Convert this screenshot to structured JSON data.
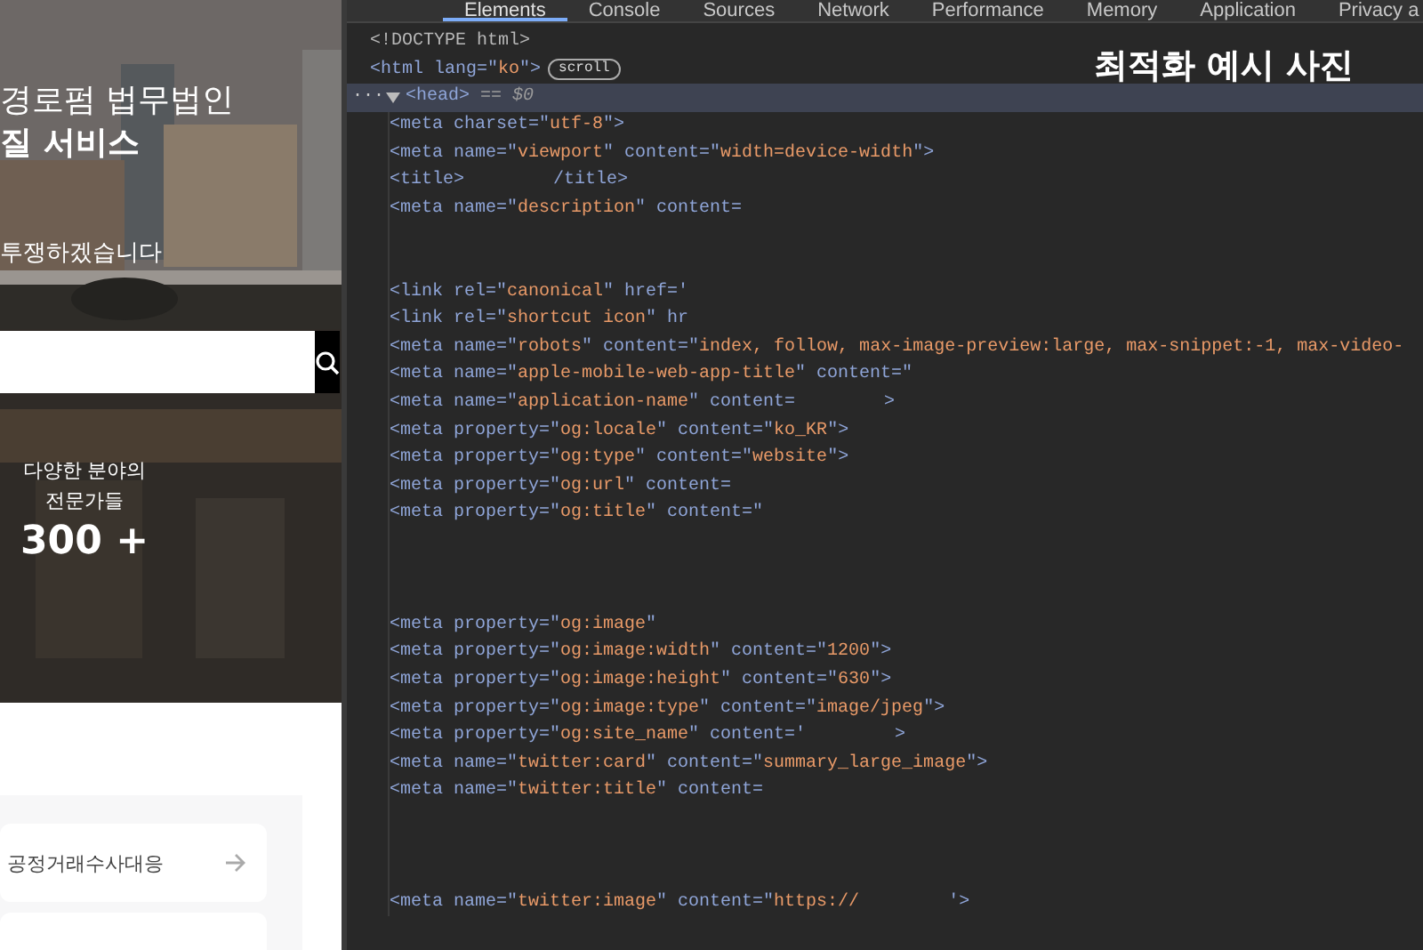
{
  "website": {
    "headline": "경로펌 법무법인",
    "subheadline": "질 서비스",
    "tagline": "투쟁하겠습니다",
    "stat": {
      "label": "다양한 분야의 전문가들",
      "value": "300 +"
    },
    "practice_areas": [
      {
        "label": "공정거래수사대응"
      }
    ]
  },
  "devtools": {
    "tabs": [
      {
        "label": "Elements",
        "selected": true
      },
      {
        "label": "Console",
        "selected": false
      },
      {
        "label": "Sources",
        "selected": false
      },
      {
        "label": "Network",
        "selected": false
      },
      {
        "label": "Performance",
        "selected": false
      },
      {
        "label": "Memory",
        "selected": false
      },
      {
        "label": "Application",
        "selected": false
      },
      {
        "label": "Privacy a",
        "selected": false
      }
    ],
    "caption": "최적화 예시 사진",
    "dom": [
      {
        "kind": "line",
        "selected": false,
        "tokens": [
          {
            "kind": "plain",
            "text": "<!DOCTYPE html>"
          }
        ]
      },
      {
        "kind": "line",
        "selected": false,
        "badge": "scroll",
        "tokens": [
          {
            "kind": "markup",
            "text": "<html lang=\""
          },
          {
            "kind": "value",
            "text": "ko"
          },
          {
            "kind": "markup",
            "text": "\">"
          }
        ],
        "children": [
          {
            "kind": "line",
            "selected": true,
            "expanded": true,
            "marker": "···",
            "note": "== $0",
            "tokens": [
              {
                "kind": "markup",
                "text": "<head>"
              }
            ],
            "children": [
              {
                "kind": "line",
                "selected": false,
                "tokens": [
                  {
                    "kind": "markup",
                    "text": "<meta charset=\""
                  },
                  {
                    "kind": "value",
                    "text": "utf-8"
                  },
                  {
                    "kind": "markup",
                    "text": "\">"
                  }
                ]
              },
              {
                "kind": "line",
                "selected": false,
                "tokens": [
                  {
                    "kind": "markup",
                    "text": "<meta name=\""
                  },
                  {
                    "kind": "value",
                    "text": "viewport"
                  },
                  {
                    "kind": "markup",
                    "text": "\" content=\""
                  },
                  {
                    "kind": "value",
                    "text": "width=device-width"
                  },
                  {
                    "kind": "markup",
                    "text": "\">"
                  }
                ]
              },
              {
                "kind": "line",
                "selected": false,
                "tokens": [
                  {
                    "kind": "markup",
                    "text": "<title>"
                  },
                  {
                    "kind": "gap"
                  },
                  {
                    "kind": "markup",
                    "text": "/title>"
                  }
                ]
              },
              {
                "kind": "line",
                "selected": false,
                "tokens": [
                  {
                    "kind": "markup",
                    "text": "<meta name=\""
                  },
                  {
                    "kind": "value",
                    "text": "description"
                  },
                  {
                    "kind": "markup",
                    "text": "\" content="
                  }
                ]
              },
              {
                "kind": "redacted",
                "selected": false
              },
              {
                "kind": "redacted",
                "selected": false
              },
              {
                "kind": "line",
                "selected": false,
                "tokens": [
                  {
                    "kind": "markup",
                    "text": "<link rel=\""
                  },
                  {
                    "kind": "value",
                    "text": "canonical"
                  },
                  {
                    "kind": "markup",
                    "text": "\" href='"
                  }
                ]
              },
              {
                "kind": "line",
                "selected": false,
                "tokens": [
                  {
                    "kind": "markup",
                    "text": "<link rel=\""
                  },
                  {
                    "kind": "value",
                    "text": "shortcut icon"
                  },
                  {
                    "kind": "markup",
                    "text": "\" hr"
                  }
                ]
              },
              {
                "kind": "line",
                "selected": false,
                "tokens": [
                  {
                    "kind": "markup",
                    "text": "<meta name=\""
                  },
                  {
                    "kind": "value",
                    "text": "robots"
                  },
                  {
                    "kind": "markup",
                    "text": "\" content=\""
                  },
                  {
                    "kind": "value",
                    "text": "index, follow, max-image-preview:large, max-snippet:-1, max-video-"
                  }
                ]
              },
              {
                "kind": "line",
                "selected": false,
                "tokens": [
                  {
                    "kind": "markup",
                    "text": "<meta name=\""
                  },
                  {
                    "kind": "value",
                    "text": "apple-mobile-web-app-title"
                  },
                  {
                    "kind": "markup",
                    "text": "\" content=\""
                  }
                ]
              },
              {
                "kind": "line",
                "selected": false,
                "tokens": [
                  {
                    "kind": "markup",
                    "text": "<meta name=\""
                  },
                  {
                    "kind": "value",
                    "text": "application-name"
                  },
                  {
                    "kind": "markup",
                    "text": "\" content="
                  },
                  {
                    "kind": "gap"
                  },
                  {
                    "kind": "markup",
                    "text": ">"
                  }
                ]
              },
              {
                "kind": "line",
                "selected": false,
                "tokens": [
                  {
                    "kind": "markup",
                    "text": "<meta property=\""
                  },
                  {
                    "kind": "value",
                    "text": "og:locale"
                  },
                  {
                    "kind": "markup",
                    "text": "\" content=\""
                  },
                  {
                    "kind": "value",
                    "text": "ko_KR"
                  },
                  {
                    "kind": "markup",
                    "text": "\">"
                  }
                ]
              },
              {
                "kind": "line",
                "selected": false,
                "tokens": [
                  {
                    "kind": "markup",
                    "text": "<meta property=\""
                  },
                  {
                    "kind": "value",
                    "text": "og:type"
                  },
                  {
                    "kind": "markup",
                    "text": "\" content=\""
                  },
                  {
                    "kind": "value",
                    "text": "website"
                  },
                  {
                    "kind": "markup",
                    "text": "\">"
                  }
                ]
              },
              {
                "kind": "line",
                "selected": false,
                "tokens": [
                  {
                    "kind": "markup",
                    "text": "<meta property=\""
                  },
                  {
                    "kind": "value",
                    "text": "og:url"
                  },
                  {
                    "kind": "markup",
                    "text": "\" content="
                  }
                ]
              },
              {
                "kind": "line",
                "selected": false,
                "tokens": [
                  {
                    "kind": "markup",
                    "text": "<meta property=\""
                  },
                  {
                    "kind": "value",
                    "text": "og:title"
                  },
                  {
                    "kind": "markup",
                    "text": "\" content=\""
                  }
                ]
              },
              {
                "kind": "redacted",
                "selected": false
              },
              {
                "kind": "redacted",
                "selected": false
              },
              {
                "kind": "redacted",
                "selected": false
              },
              {
                "kind": "line",
                "selected": false,
                "tokens": [
                  {
                    "kind": "markup",
                    "text": "<meta property=\""
                  },
                  {
                    "kind": "value",
                    "text": "og:image"
                  },
                  {
                    "kind": "markup",
                    "text": "\""
                  }
                ]
              },
              {
                "kind": "line",
                "selected": false,
                "tokens": [
                  {
                    "kind": "markup",
                    "text": "<meta property=\""
                  },
                  {
                    "kind": "value",
                    "text": "og:image:width"
                  },
                  {
                    "kind": "markup",
                    "text": "\" content=\""
                  },
                  {
                    "kind": "value",
                    "text": "1200"
                  },
                  {
                    "kind": "markup",
                    "text": "\">"
                  }
                ]
              },
              {
                "kind": "line",
                "selected": false,
                "tokens": [
                  {
                    "kind": "markup",
                    "text": "<meta property=\""
                  },
                  {
                    "kind": "value",
                    "text": "og:image:height"
                  },
                  {
                    "kind": "markup",
                    "text": "\" content=\""
                  },
                  {
                    "kind": "value",
                    "text": "630"
                  },
                  {
                    "kind": "markup",
                    "text": "\">"
                  }
                ]
              },
              {
                "kind": "line",
                "selected": false,
                "tokens": [
                  {
                    "kind": "markup",
                    "text": "<meta property=\""
                  },
                  {
                    "kind": "value",
                    "text": "og:image:type"
                  },
                  {
                    "kind": "markup",
                    "text": "\" content=\""
                  },
                  {
                    "kind": "value",
                    "text": "image/jpeg"
                  },
                  {
                    "kind": "markup",
                    "text": "\">"
                  }
                ]
              },
              {
                "kind": "line",
                "selected": false,
                "tokens": [
                  {
                    "kind": "markup",
                    "text": "<meta property=\""
                  },
                  {
                    "kind": "value",
                    "text": "og:site_name"
                  },
                  {
                    "kind": "markup",
                    "text": "\" content='"
                  },
                  {
                    "kind": "gap"
                  },
                  {
                    "kind": "markup",
                    "text": ">"
                  }
                ]
              },
              {
                "kind": "line",
                "selected": false,
                "tokens": [
                  {
                    "kind": "markup",
                    "text": "<meta name=\""
                  },
                  {
                    "kind": "value",
                    "text": "twitter:card"
                  },
                  {
                    "kind": "markup",
                    "text": "\" content=\""
                  },
                  {
                    "kind": "value",
                    "text": "summary_large_image"
                  },
                  {
                    "kind": "markup",
                    "text": "\">"
                  }
                ]
              },
              {
                "kind": "line",
                "selected": false,
                "tokens": [
                  {
                    "kind": "markup",
                    "text": "<meta name=\""
                  },
                  {
                    "kind": "value",
                    "text": "twitter:title"
                  },
                  {
                    "kind": "markup",
                    "text": "\" content="
                  }
                ]
              },
              {
                "kind": "redacted",
                "selected": false
              },
              {
                "kind": "redacted",
                "selected": false
              },
              {
                "kind": "redacted",
                "selected": false
              },
              {
                "kind": "line",
                "selected": false,
                "tokens": [
                  {
                    "kind": "markup",
                    "text": "<meta name=\""
                  },
                  {
                    "kind": "value",
                    "text": "twitter:image"
                  },
                  {
                    "kind": "markup",
                    "text": "\" content=\""
                  },
                  {
                    "kind": "value",
                    "text": "https://"
                  },
                  {
                    "kind": "gap"
                  },
                  {
                    "kind": "markup",
                    "text": "'>"
                  }
                ]
              }
            ]
          }
        ]
      }
    ]
  }
}
